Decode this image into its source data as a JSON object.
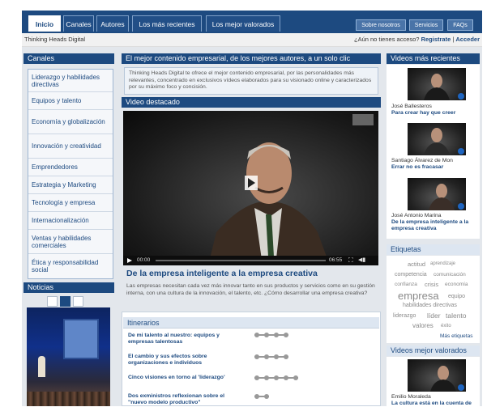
{
  "nav": {
    "tabs": [
      "Inicio",
      "Canales",
      "Autores",
      "Los más recientes",
      "Los mejor valorados"
    ],
    "right_tabs": [
      "Sobre nosotros",
      "Servicios",
      "FAQs"
    ]
  },
  "subbar": {
    "site": "Thinking Heads Digital",
    "question": "¿Aún no tienes acceso?",
    "register": "Registrate",
    "sep": "|",
    "login": "Acceder"
  },
  "canales": {
    "title": "Canales",
    "items": [
      "Liderazgo y habilidades directivas",
      "Equipos y talento",
      "Economía y globalización",
      "Innovación y creatividad",
      "Emprendedores",
      "Estrategia y Marketing",
      "Tecnología y empresa",
      "Internacionalización",
      "Ventas y habilidades comerciales",
      "Ética y responsabilidad social"
    ]
  },
  "noticias": {
    "title": "Noticias"
  },
  "main": {
    "headline": "El mejor contenido empresarial, de los mejores autores, a un solo clic",
    "intro": "Thinking Heads Digital te ofrece el mejor contenido empresarial, por las personalidades más relevantes, concentrado en exclusivos vídeos elaborados para su visionado online y caracterizados por su máximo foco y concisión.",
    "featured_label": "Video destacado",
    "player": {
      "current": "00:00",
      "duration": "06:55",
      "progress": 0
    },
    "video_title": "De la empresa inteligente a la empresa creativa",
    "video_desc": "Las empresas necesitan cada vez más innovar tanto en sus productos y servicios como en su gestión interna, con una cultura de la innovación, el talento, etc. ¿Cómo desarrollar una empresa creativa?"
  },
  "itinerarios": {
    "title": "Itinerarios",
    "items": [
      {
        "title": "De mi talento al nuestro: equipos y empresas talentosas",
        "steps": 4
      },
      {
        "title": "El cambio y sus efectos sobre organizaciones e individuos",
        "steps": 4
      },
      {
        "title": "Cinco visiones en torno al 'liderazgo'",
        "steps": 5
      },
      {
        "title": "Dos exministros reflexionan sobre el \"nuevo modelo productivo\"",
        "steps": 2
      }
    ]
  },
  "recientes": {
    "title": "Videos más recientes",
    "items": [
      {
        "author": "José Ballesteros",
        "title": "Para crear hay que creer"
      },
      {
        "author": "Santiago Álvarez de Mon",
        "title": "Errar no es fracasar"
      },
      {
        "author": "José Antonio Marina",
        "title": "De la empresa inteligente a la empresa creativa"
      }
    ]
  },
  "etiquetas": {
    "title": "Etiquetas",
    "tags": [
      "actitud",
      "aprendizaje",
      "competencia",
      "comunicación",
      "confianza",
      "crisis",
      "economía",
      "empresa",
      "equipo",
      "habilidades directivas",
      "liderazgo",
      "líder",
      "talento",
      "valores",
      "éxito"
    ],
    "more": "Más etiquetas"
  },
  "valorados": {
    "title": "Videos mejor valorados",
    "items": [
      {
        "author": "Emilio Moraleda",
        "title": "La cultura está en la cuenta de"
      }
    ]
  },
  "colors": {
    "brand": "#1d4a80",
    "panel_bg": "#e3e7ec",
    "link": "#1d4a80"
  }
}
